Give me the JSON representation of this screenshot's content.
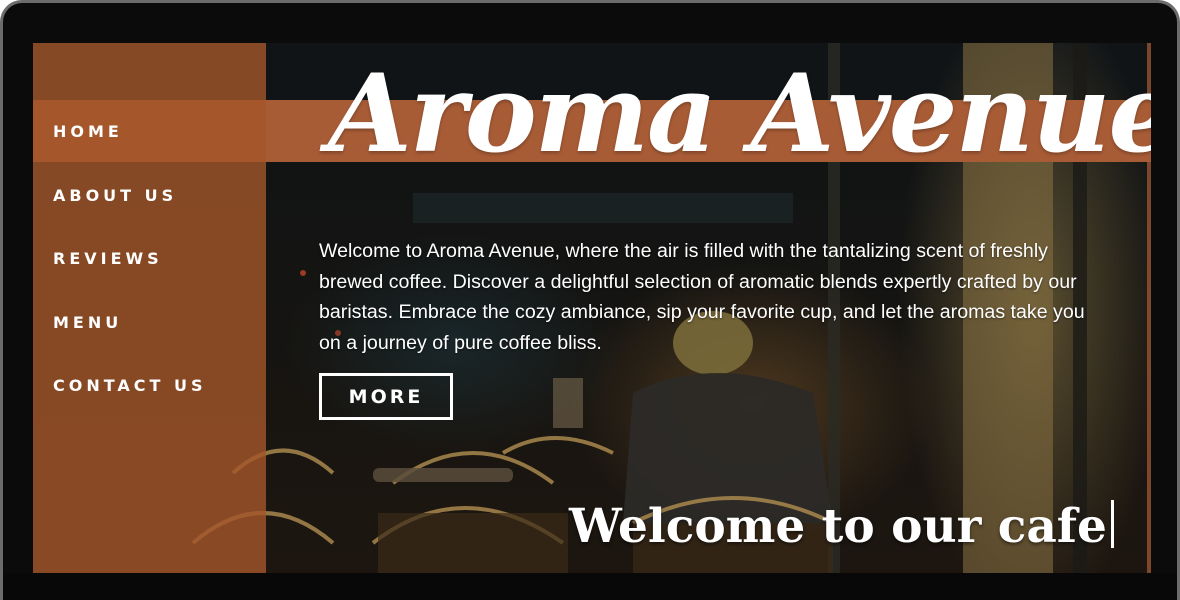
{
  "site": {
    "title": "Aroma Avenue",
    "intro": "Welcome to Aroma Avenue, where the air is filled with the tantalizing scent of freshly brewed coffee. Discover a delightful selection of aromatic blends expertly crafted by our baristas. Embrace the cozy ambiance, sip your favorite cup, and let the aromas take you on a journey of pure coffee bliss.",
    "more_label": "MORE",
    "welcome_heading": "Welcome to our cafe"
  },
  "nav": {
    "items": [
      {
        "label": "HOME",
        "active": true
      },
      {
        "label": "ABOUT US"
      },
      {
        "label": "REVIEWS"
      },
      {
        "label": "MENU"
      },
      {
        "label": "CONTACT US"
      }
    ]
  },
  "colors": {
    "accent": "#a85c36",
    "sidebar": "#a45629",
    "text": "#ffffff",
    "bezel": "#0b0b0b"
  },
  "icons": {
    "background": "cafe-photo"
  }
}
